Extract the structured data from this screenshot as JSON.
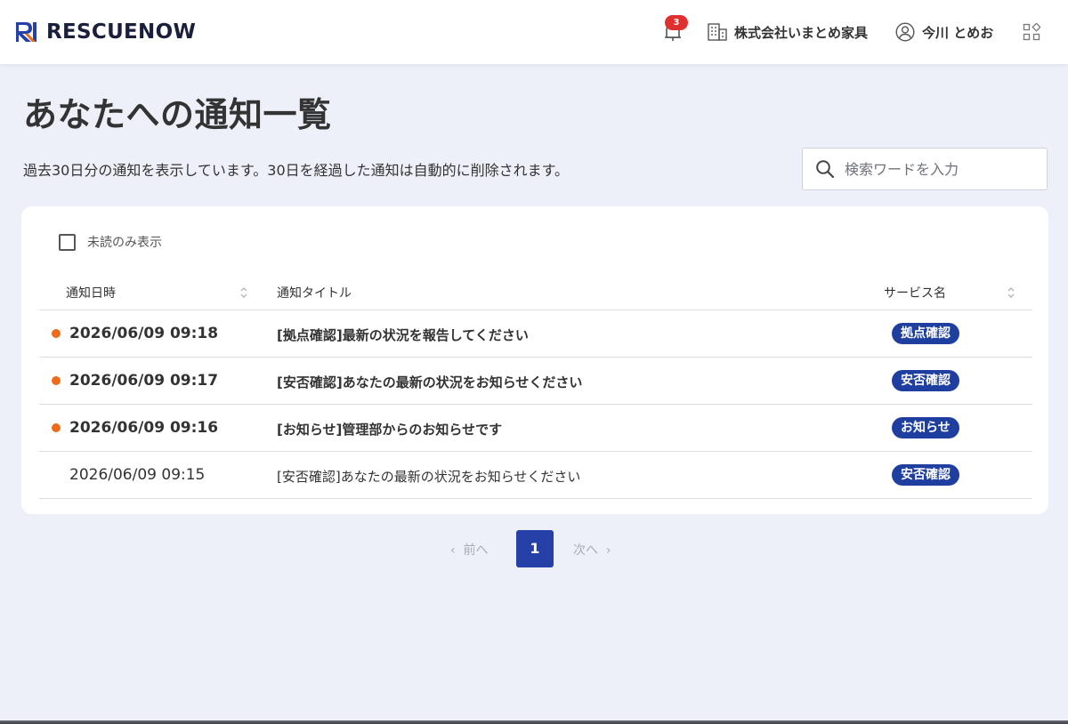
{
  "header": {
    "logo_text": "RESCUENOW",
    "notification_count": "3",
    "company_name": "株式会社いまとめ家具",
    "user_name": "今川 とめお",
    "icons": [
      "bell-icon",
      "building-icon",
      "user-circle-icon",
      "apps-grid-icon"
    ]
  },
  "page": {
    "title": "あなたへの通知一覧",
    "description": "過去30日分の通知を表示しています。30日を経過した通知は自動的に削除されます。"
  },
  "search": {
    "placeholder": "検索ワードを入力",
    "value": ""
  },
  "filter": {
    "unread_only_label": "未読のみ表示",
    "checked": false
  },
  "table": {
    "columns": [
      "通知日時",
      "通知タイトル",
      "サービス名"
    ],
    "rows": [
      {
        "unread": true,
        "datetime": "2026/06/09 09:18",
        "title": "[拠点確認]最新の状況を報告してください",
        "service": "拠点確認"
      },
      {
        "unread": true,
        "datetime": "2026/06/09 09:17",
        "title": "[安否確認]あなたの最新の状況をお知らせください",
        "service": "安否確認"
      },
      {
        "unread": true,
        "datetime": "2026/06/09 09:16",
        "title": "[お知らせ]管理部からのお知らせです",
        "service": "お知らせ"
      },
      {
        "unread": false,
        "datetime": "2026/06/09 09:15",
        "title": "[安否確認]あなたの最新の状況をお知らせください",
        "service": "安否確認"
      }
    ]
  },
  "pagination": {
    "prev_label": "前へ",
    "next_label": "次へ",
    "current_page": "1"
  },
  "colors": {
    "brand_blue": "#2541a8",
    "badge_blue": "#1e3fa0",
    "unread_dot": "#ee6b1c",
    "notification_badge": "#e02f2f",
    "background": "#eef0f9"
  }
}
